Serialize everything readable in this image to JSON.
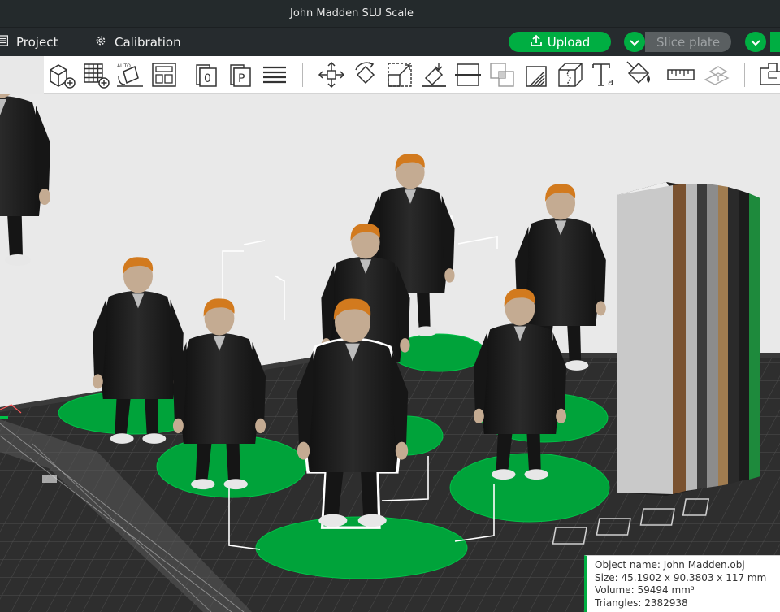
{
  "window": {
    "title": "John Madden SLU Scale"
  },
  "menu": {
    "project_label": "Project",
    "calibration_label": "Calibration"
  },
  "actions": {
    "upload_label": "Upload",
    "slice_label": "Slice plate"
  },
  "toolbar_icons": [
    "add-object-icon",
    "add-plate-icon",
    "auto-orient-icon",
    "arrange-icon",
    "plate-0-icon",
    "plate-p-icon",
    "layers-icon",
    "move-icon",
    "rotate-icon",
    "scale-icon",
    "lay-on-face-icon",
    "cut-icon",
    "boolean-icon",
    "support-paint-icon",
    "seam-paint-icon",
    "text-icon",
    "color-paint-icon",
    "measure-icon",
    "assembly-icon",
    "assembly-view-icon"
  ],
  "object_info": {
    "name": "Object name: John Madden.obj",
    "size": "Size: 45.1902 x 90.3803 x 117 mm",
    "volume": "Volume: 59494 mm³",
    "triangles": "Triangles: 2382938"
  },
  "colors": {
    "accent": "#00ae42",
    "titlebar": "#242a2c",
    "bed": "#2f2f2f",
    "base_plate": "#00a23a",
    "figure_coat": "#1c1c1c",
    "figure_hair": "#d0761c",
    "figure_skin": "#c0a890",
    "purge_tower": [
      "#c8c8c8",
      "#7a5230",
      "#bdbdbd",
      "#3c3c3c",
      "#888888",
      "#a07c50",
      "#2a2a2a",
      "#1e8a3c"
    ]
  }
}
